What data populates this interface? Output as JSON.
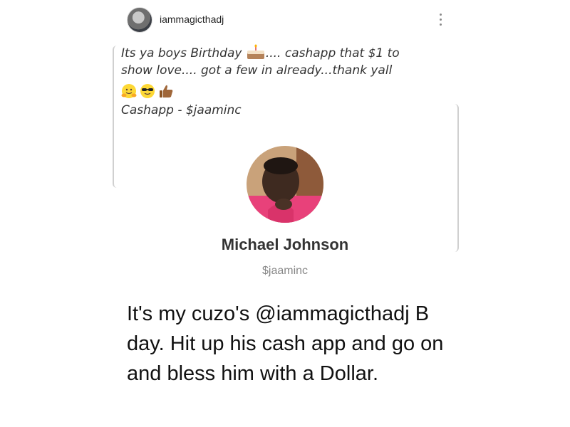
{
  "post": {
    "username": "iammagicthadj",
    "text_line1_a": "Its ya boys Birthday",
    "text_line1_b": ".... cashapp that $1 to",
    "text_line2": "show love.... got a few in already...thank yall",
    "cashapp_line": "Cashapp - $jaaminc",
    "emojis": [
      "hugging-face-icon",
      "sunglasses-face-icon",
      "thumbs-up-icon"
    ]
  },
  "profile": {
    "name": "Michael Johnson",
    "handle": "$jaaminc"
  },
  "caption": "It's my cuzo's @iammagicthadj B day. Hit up his cash app and go on and bless him with a Dollar."
}
